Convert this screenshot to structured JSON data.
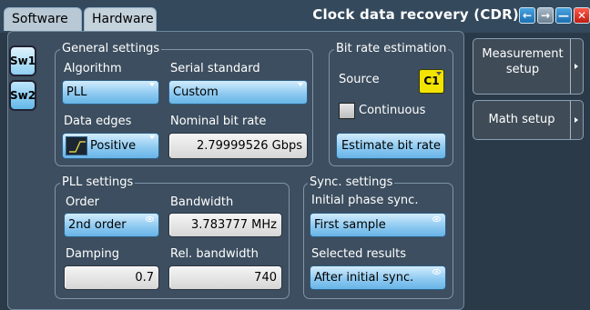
{
  "tabs": {
    "software": "Software",
    "hardware": "Hardware"
  },
  "window": {
    "title": "Clock data recovery (CDR)"
  },
  "sw_tabs": [
    "Sw1",
    "Sw2"
  ],
  "general": {
    "title": "General settings",
    "algorithm_label": "Algorithm",
    "algorithm_value": "PLL",
    "serial_label": "Serial standard",
    "serial_value": "Custom",
    "edges_label": "Data edges",
    "edges_value": "Positive",
    "nominal_label": "Nominal bit rate",
    "nominal_value": "2.79999526 Gbps"
  },
  "bitrate": {
    "title": "Bit rate estimation",
    "source_label": "Source",
    "source_value": "C1",
    "continuous_label": "Continuous",
    "estimate_button": "Estimate bit rate"
  },
  "pll": {
    "title": "PLL settings",
    "order_label": "Order",
    "order_value": "2nd order",
    "bandwidth_label": "Bandwidth",
    "bandwidth_value": "3.783777 MHz",
    "damping_label": "Damping",
    "damping_value": "0.7",
    "relbw_label": "Rel. bandwidth",
    "relbw_value": "740"
  },
  "sync": {
    "title": "Sync. settings",
    "initial_label": "Initial phase sync.",
    "initial_value": "First sample",
    "selected_label": "Selected results",
    "selected_value": "After initial sync."
  },
  "sidebar": {
    "measurement_line1": "Measurement",
    "measurement_line2": "setup",
    "math": "Math setup"
  },
  "colors": {
    "accent": "#7cc4f0",
    "source_badge": "#f2e400",
    "window_close": "#e0281a"
  },
  "icons": [
    "back-icon",
    "forward-icon",
    "minimize-icon",
    "close-icon",
    "rising-edge-icon",
    "dropdown-triangle-icon",
    "eye-icon",
    "submenu-arrow-icon"
  ]
}
